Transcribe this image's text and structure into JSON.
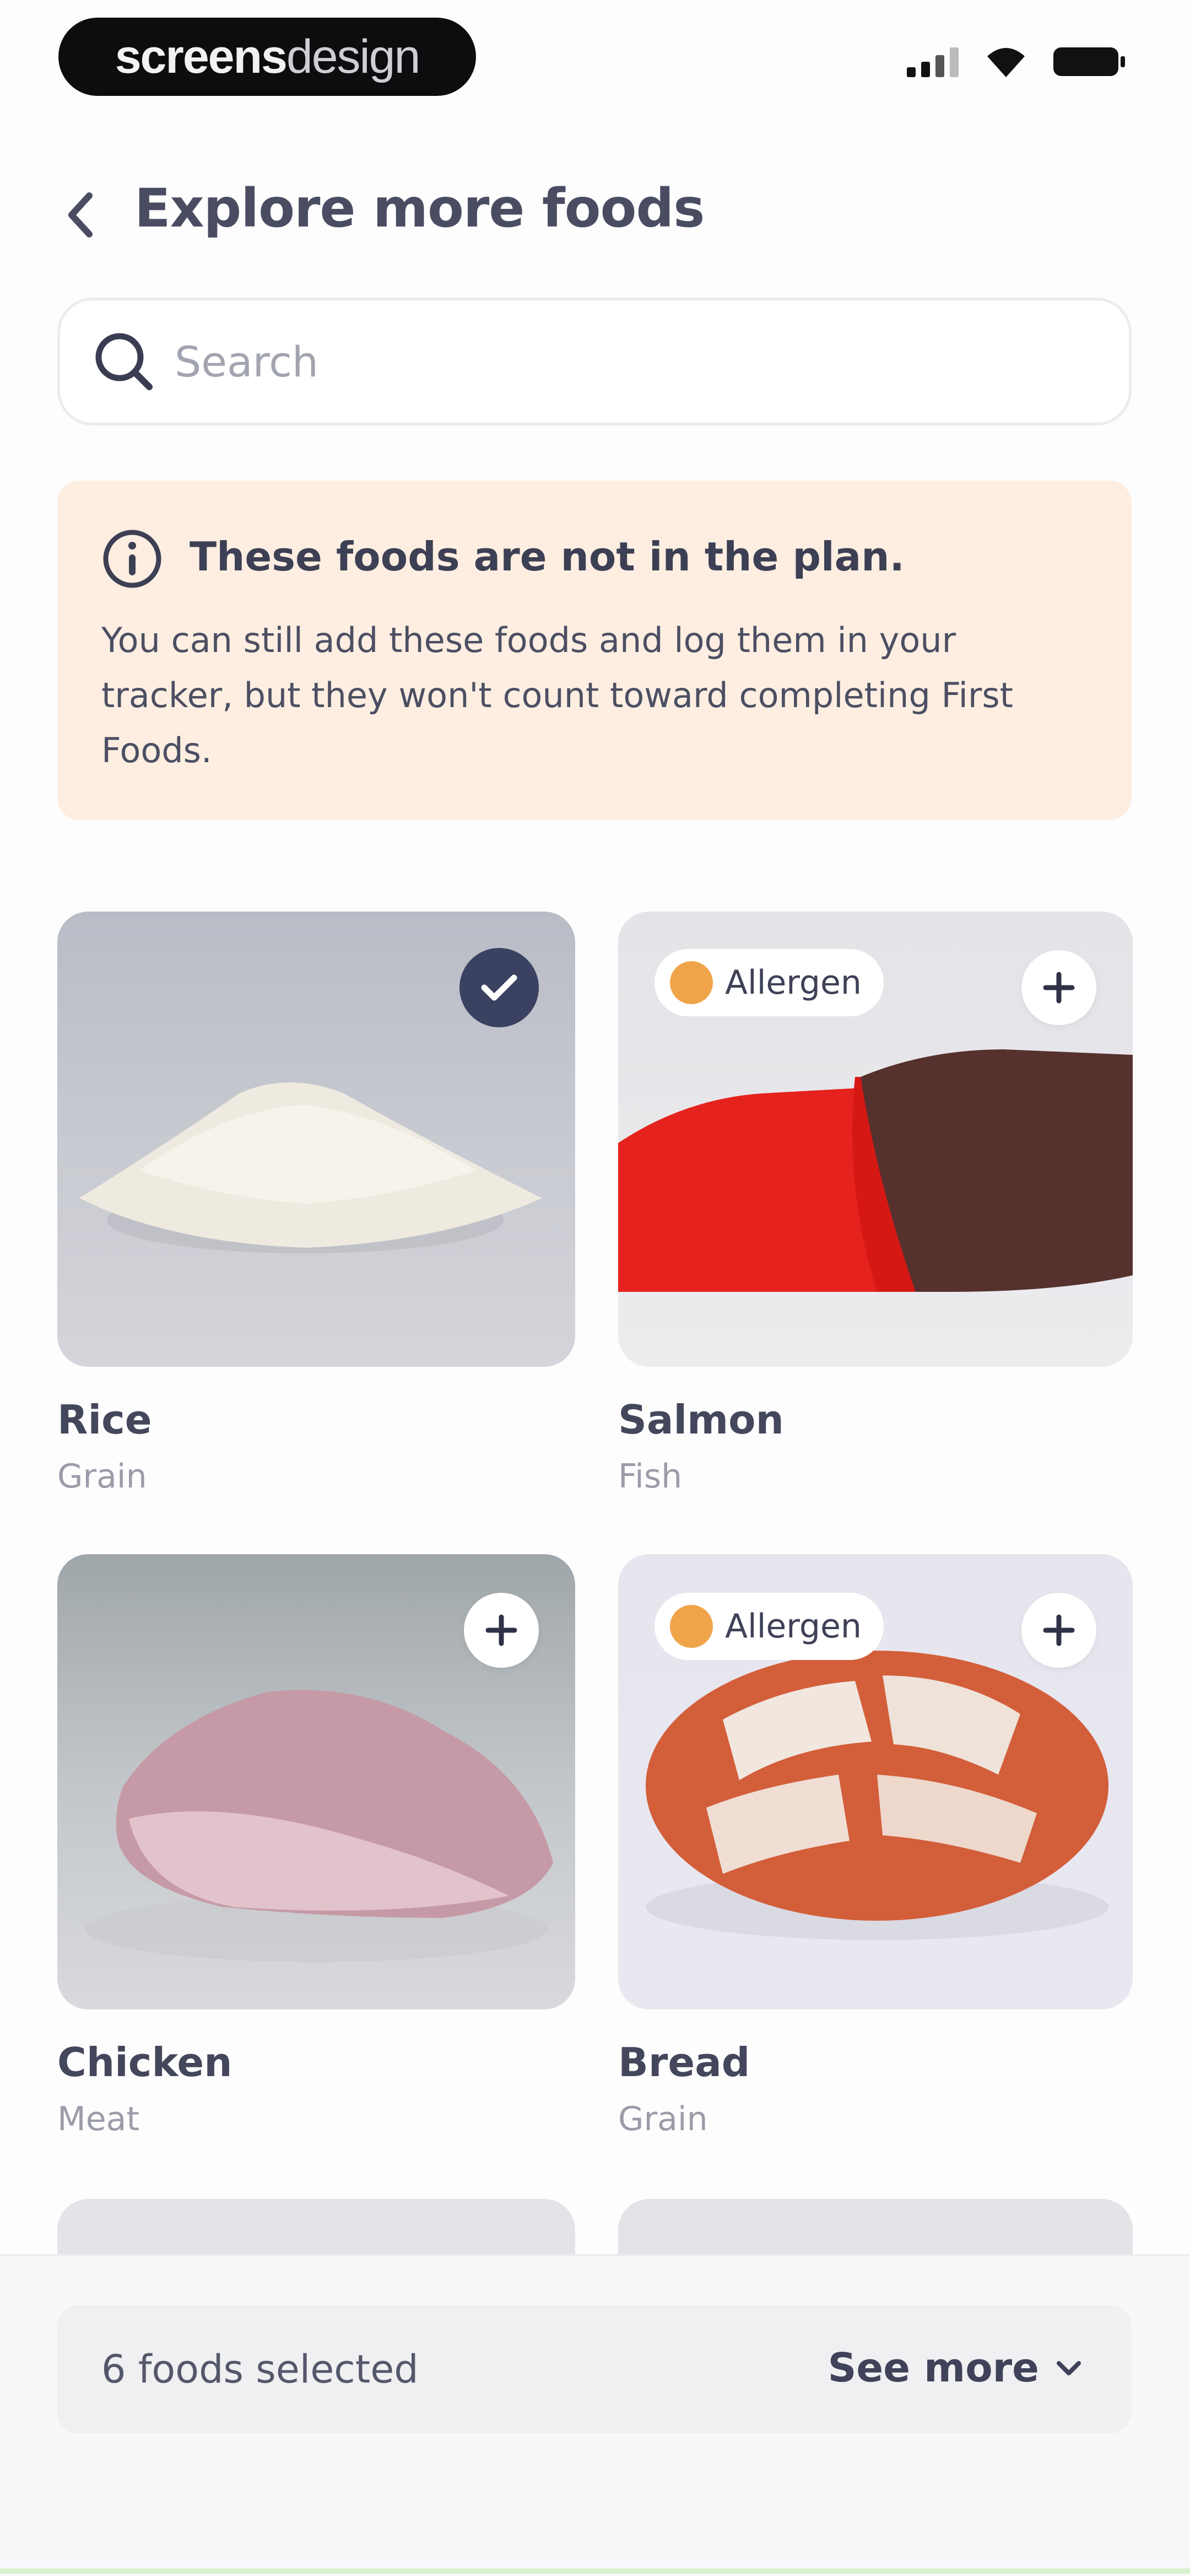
{
  "status_bar": {
    "logo_bold": "screens",
    "logo_light": "design"
  },
  "header": {
    "title": "Explore more foods"
  },
  "search": {
    "placeholder": "Search"
  },
  "notice": {
    "title": "These foods are not in the plan.",
    "body": "You can still add these foods and log them in your tracker, but they won't count toward completing First Foods."
  },
  "foods": [
    {
      "name": "Rice",
      "category": "Grain",
      "selected": true,
      "allergen": false
    },
    {
      "name": "Salmon",
      "category": "Fish",
      "selected": false,
      "allergen": true,
      "allergen_label": "Allergen"
    },
    {
      "name": "Chicken",
      "category": "Meat",
      "selected": false,
      "allergen": false
    },
    {
      "name": "Bread",
      "category": "Grain",
      "selected": false,
      "allergen": true,
      "allergen_label": "Allergen"
    }
  ],
  "footer": {
    "selected_text": "6 foods selected",
    "see_more_label": "See more"
  },
  "colors": {
    "notice_bg": "#fdeee1",
    "allergen_dot": "#f0a44a",
    "check_bg": "#3b4160"
  }
}
